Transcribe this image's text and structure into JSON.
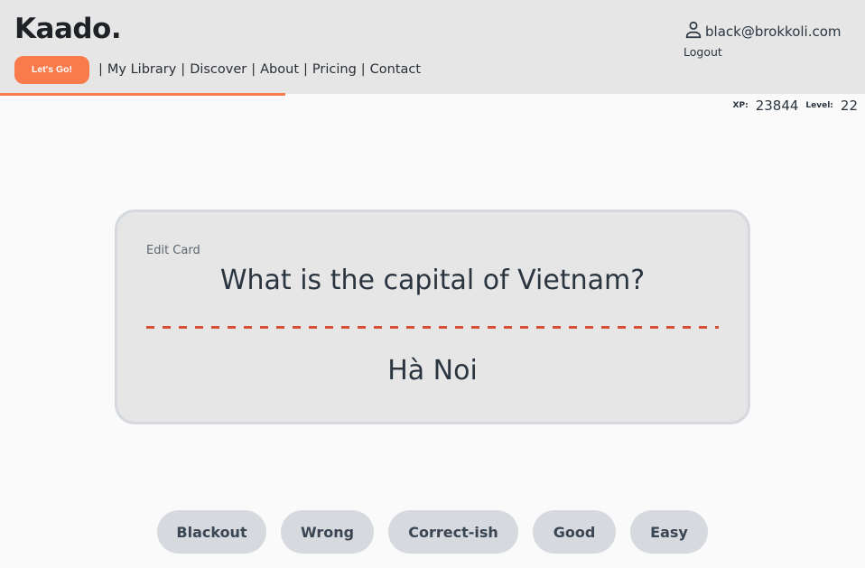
{
  "header": {
    "brand": "Kaado.",
    "cta_label": "Let's Go!",
    "nav": [
      {
        "label": "My Library"
      },
      {
        "label": "Discover"
      },
      {
        "label": "About"
      },
      {
        "label": "Pricing"
      },
      {
        "label": "Contact"
      }
    ],
    "separator": "|",
    "user_email": "black@brokkoli.com",
    "logout_label": "Logout",
    "accent_color": "#f97a4a"
  },
  "progress": {
    "percent": 33
  },
  "stats": {
    "xp_label": "XP:",
    "xp_value": "23844",
    "level_label": "Level:",
    "level_value": "22"
  },
  "card": {
    "edit_label": "Edit Card",
    "question": "What is the capital of Vietnam?",
    "answer": "Hà Noi",
    "divider_color": "#d84f35"
  },
  "ratings": [
    {
      "label": "Blackout"
    },
    {
      "label": "Wrong"
    },
    {
      "label": "Correct-ish"
    },
    {
      "label": "Good"
    },
    {
      "label": "Easy"
    }
  ]
}
